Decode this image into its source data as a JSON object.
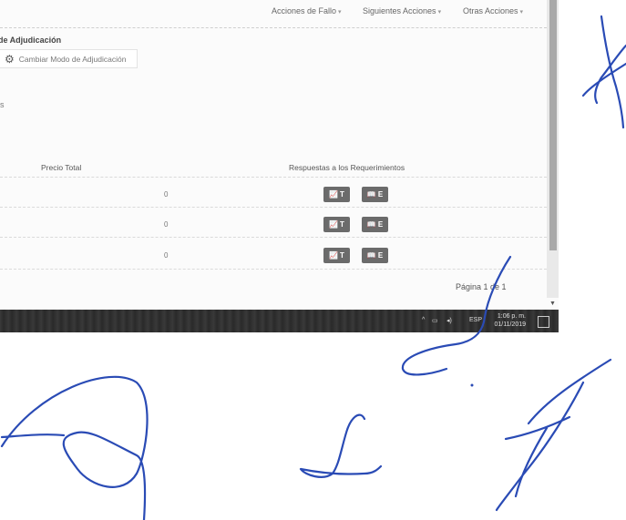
{
  "toolbar": {
    "failure_actions": "Acciones de Fallo",
    "next_actions": "Siguientes Acciones",
    "other_actions": "Otras Acciones"
  },
  "section": {
    "title": "de Adjudicación",
    "change_mode_button": "Cambiar Modo de Adjudicación",
    "stray_text": "s"
  },
  "table": {
    "headers": [
      "Precio Total",
      "Respuestas a los Requerimientos"
    ],
    "rows": [
      {
        "total": "0",
        "btn_t": "T",
        "btn_e": "E"
      },
      {
        "total": "0",
        "btn_t": "T",
        "btn_e": "E"
      },
      {
        "total": "0",
        "btn_t": "T",
        "btn_e": "E"
      }
    ]
  },
  "pagination": {
    "label": "Página 1 de 1"
  },
  "taskbar": {
    "lang": "ESP",
    "time": "1:06 p. m.",
    "date": "01/11/2019"
  },
  "icons": {
    "gear": "gear-icon",
    "caret": "caret-down-icon",
    "chart": "chart-icon",
    "book": "book-icon",
    "notification": "notification-icon"
  },
  "colors": {
    "ink": "#2a4bb5",
    "pill": "#6b6b6b",
    "taskbar": "#2f2f2f"
  }
}
